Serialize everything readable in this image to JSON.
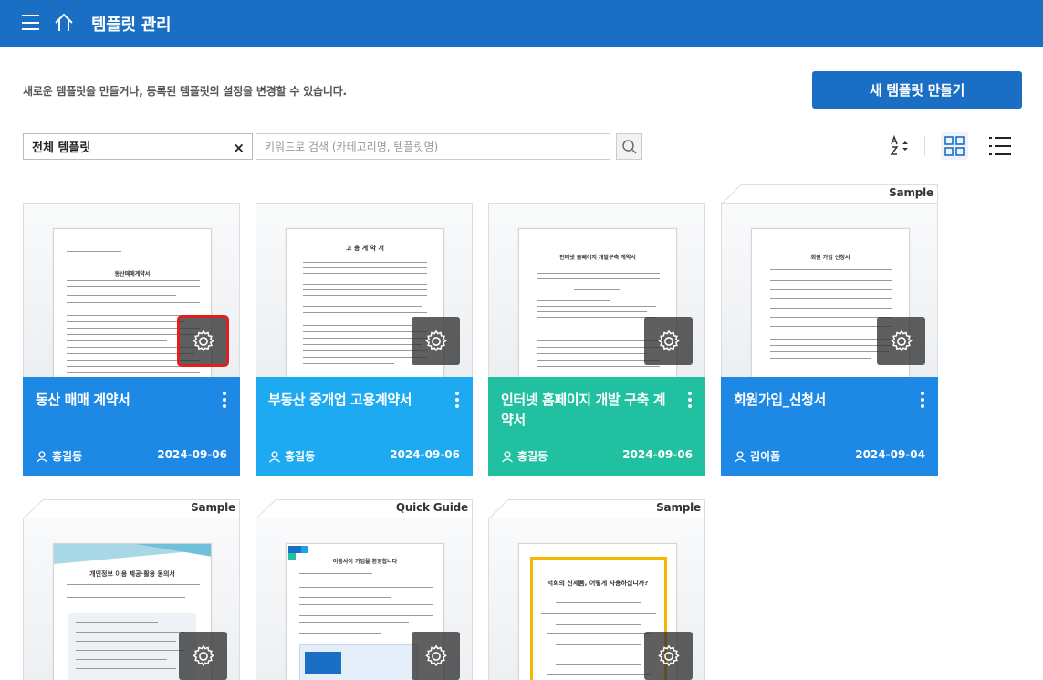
{
  "header": {
    "title": "템플릿 관리",
    "menu_icon": "hamburger-icon",
    "home_icon": "home-icon"
  },
  "description": "새로운 템플릿을 만들거나, 등록된 템플릿의 설정을 변경할 수 있습니다.",
  "new_button": "새 템플릿 만들기",
  "filter": {
    "category_value": "전체 템플릿",
    "clear_icon": "×",
    "search_placeholder": "키워드로 검색 (카테고리명, 템플릿명)"
  },
  "colors": {
    "primary": "#1a6fc4",
    "card_blue": "#1e88e5",
    "card_cyan": "#1eaaf0",
    "card_teal": "#20c0a0",
    "selection": "#e02020"
  },
  "cards": [
    {
      "title": "동산 매매 계약서",
      "author": "홍길동",
      "date": "2024-09-06",
      "doc_title": "동산매매계약서"
    },
    {
      "title": "부동산 중개업 고용계약서",
      "author": "홍길동",
      "date": "2024-09-06",
      "doc_title": "고 용 계 약 서"
    },
    {
      "title": "인터넷 홈페이지 개발 구축 계약서",
      "author": "홍길동",
      "date": "2024-09-06",
      "doc_title": "인터넷 홈페이지 개발구축 계약서"
    },
    {
      "title": "회원가입_신청서",
      "author": "김이폼",
      "date": "2024-09-04",
      "tag": "Sample",
      "doc_title": "회원 가입 신청서"
    },
    {
      "tag": "Sample",
      "doc_title": "개인정보 이용 제공·활용 동의서"
    },
    {
      "tag": "Quick Guide",
      "doc_title": "이폼사이 가입을 환영합니다"
    },
    {
      "tag": "Sample",
      "doc_title": "저희의 신제품, 어떻게 사용하십니까?"
    }
  ]
}
